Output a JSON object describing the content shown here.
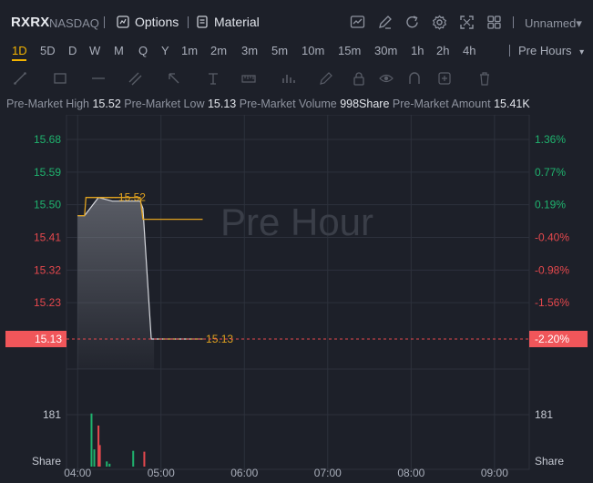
{
  "header": {
    "symbol": "RXRX",
    "exchange": "NASDAQ",
    "options_label": "Options",
    "material_label": "Material",
    "layout_label": "Unnamed▾",
    "icons": [
      "chart-style-icon",
      "draw-icon",
      "refresh-icon",
      "settings-icon",
      "fullscreen-icon",
      "layout-icon"
    ]
  },
  "periods": {
    "items": [
      "1D",
      "5D",
      "D",
      "W",
      "M",
      "Q",
      "Y",
      "1m",
      "2m",
      "3m",
      "5m",
      "10m",
      "15m",
      "30m",
      "1h",
      "2h",
      "4h"
    ],
    "active": "1D",
    "session_label": "Pre Hours",
    "session_caret": "▾"
  },
  "stats": {
    "high_label": "Pre-Market High",
    "high_value": "15.52",
    "low_label": "Pre-Market Low",
    "low_value": "15.13",
    "volume_label": "Pre-Market Volume",
    "volume_value": "998Share",
    "amount_label": "Pre-Market Amount",
    "amount_value": "15.41K"
  },
  "colors": {
    "price_line": "#e0a21f",
    "up": "#1fb36e",
    "down": "#e5484d",
    "current_price_bg": "#f0565a"
  },
  "chart_data": {
    "type": "line",
    "watermark": "Pre Hour",
    "x_ticks": [
      "04:00",
      "05:00",
      "06:00",
      "07:00",
      "08:00",
      "09:00"
    ],
    "price_axis_left": [
      "15.68",
      "15.59",
      "15.50",
      "15.41",
      "15.32",
      "15.23",
      "15.13"
    ],
    "percent_axis_right": [
      "1.36%",
      "0.77%",
      "0.19%",
      "-0.40%",
      "-0.98%",
      "-1.56%",
      "-2.20%"
    ],
    "current_price": "15.13",
    "current_percent": "-2.20%",
    "high_marker": "15.52",
    "low_marker": "15.13",
    "series": [
      {
        "x": [
          "04:00",
          "04:05",
          "04:15",
          "04:25",
          "04:35",
          "04:45",
          "04:47",
          "04:53",
          "04:55",
          "05:00",
          "05:10",
          "05:20",
          "05:30"
        ],
        "values": [
          15.47,
          15.47,
          15.52,
          15.51,
          15.51,
          15.51,
          15.49,
          15.13,
          15.13,
          15.13,
          15.13,
          15.13,
          15.13
        ]
      }
    ],
    "volume_axis": [
      "181",
      "Share"
    ],
    "volume_series": [
      {
        "x": "04:10",
        "value": 185,
        "dir": "up"
      },
      {
        "x": "04:12",
        "value": 60,
        "dir": "up"
      },
      {
        "x": "04:15",
        "value": 143,
        "dir": "down"
      },
      {
        "x": "04:16",
        "value": 75,
        "dir": "down"
      },
      {
        "x": "04:21",
        "value": 18,
        "dir": "up"
      },
      {
        "x": "04:23",
        "value": 10,
        "dir": "up"
      },
      {
        "x": "04:40",
        "value": 55,
        "dir": "up"
      },
      {
        "x": "04:48",
        "value": 52,
        "dir": "down"
      }
    ]
  }
}
